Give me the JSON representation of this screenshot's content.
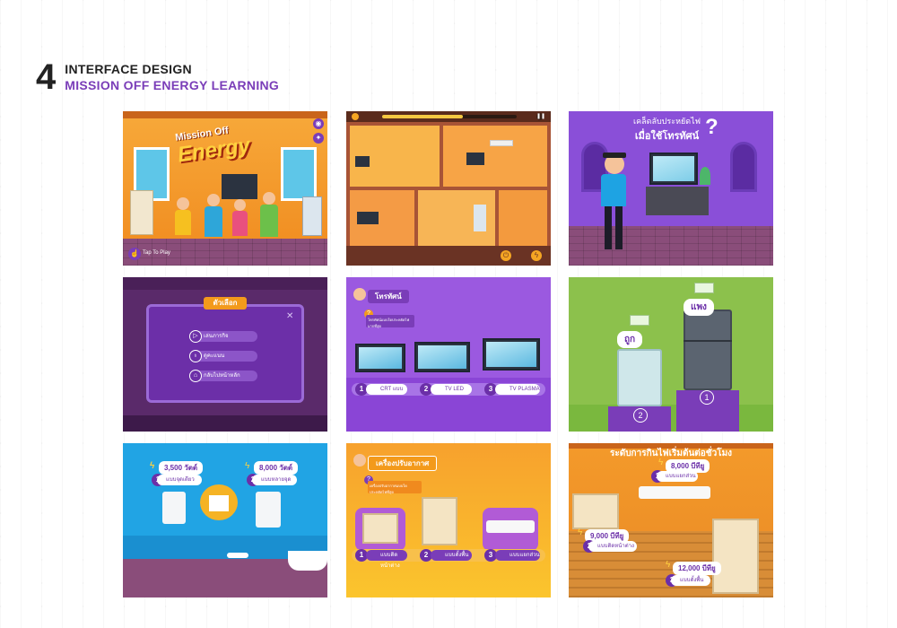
{
  "header": {
    "number": "4",
    "title": "INTERFACE DESIGN",
    "subtitle": "MISSION OFF ENERGY LEARNING"
  },
  "colors": {
    "purple": "#7a3db8",
    "orange": "#f39a1b",
    "green": "#8bc34a",
    "sky": "#1ea3e3"
  },
  "panel1": {
    "logo_line1": "Mission Off",
    "logo_line2": "Energy",
    "play_button": "Tap To Play",
    "icons": [
      "eye-icon",
      "bulb-icon",
      "hand-tap-icon"
    ]
  },
  "panel2": {
    "icons": [
      "clock-icon",
      "pause-icon",
      "power-icon",
      "lightning-icon"
    ]
  },
  "panel3": {
    "title_line1": "เคล็ดลับประหยัดไฟ",
    "title_line2": "เมื่อใช้โทรทัศน์",
    "question_mark": "?"
  },
  "panel4": {
    "menu_title": "ตัวเลือก",
    "menu_items": [
      "เล่นภารกิจ",
      "ดูคะแนน",
      "กลับไปหน้าหลัก"
    ],
    "close": "✕",
    "icons": [
      "play-icon",
      "bulb-icon",
      "home-icon"
    ]
  },
  "panel5": {
    "tab": "โทรทัศน์",
    "question_num": "?",
    "question": "โทรทัศน์แบบใดประหยัดไฟมากที่สุด",
    "options": [
      {
        "num": "1",
        "label": "CRT แบบ"
      },
      {
        "num": "2",
        "label": "TV LED"
      },
      {
        "num": "3",
        "label": "TV PLASMA"
      }
    ]
  },
  "panel6": {
    "label_expensive": "แพง",
    "label_cheap": "ถูก",
    "num_left": "2",
    "num_right": "1"
  },
  "panel7": {
    "heater1_watts": "3,500 วัตต์",
    "heater1_type": "แบบจุดเดียว",
    "heater1_num": "1",
    "heater2_watts": "8,000 วัตต์",
    "heater2_type": "แบบหลายจุด",
    "heater2_num": "2"
  },
  "panel8": {
    "tab": "เครื่องปรับอากาศ",
    "question_num": "?",
    "question": "เครื่องปรับอากาศแบบใดประหยัดไฟที่สุด",
    "options": [
      {
        "num": "1",
        "label": "แบบติดหน้าต่าง"
      },
      {
        "num": "2",
        "label": "แบบตั้งพื้น"
      },
      {
        "num": "3",
        "label": "แบบแยกส่วน"
      }
    ]
  },
  "panel9": {
    "title": "ระดับการกินไฟเริ่มต้นต่อชั่วโมง",
    "items": [
      {
        "num": "1",
        "value": "8,000 บีทียู",
        "label": "แบบแยกส่วน"
      },
      {
        "num": "2",
        "value": "9,000 บีทียู",
        "label": "แบบติดหน้าต่าง"
      },
      {
        "num": "3",
        "value": "12,000 บีทียู",
        "label": "แบบตั้งพื้น"
      }
    ]
  }
}
